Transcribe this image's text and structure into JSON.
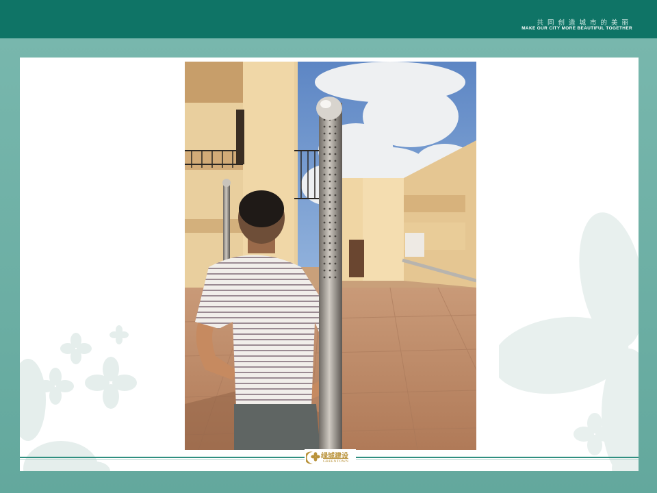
{
  "header": {
    "slogan_cn": "共同创造城市的美丽",
    "slogan_en": "MAKE OUR CITY MORE BEAUTIFUL TOGETHER"
  },
  "photo": {
    "subject": "man-standing-beside-perforated-stainless-pole-on-tiled-rooftop"
  },
  "footer": {
    "logo_cn": "绿城建设",
    "logo_en": "GREENTOWN"
  },
  "colors": {
    "header_bar": "#0f7466",
    "background": "#6fb0a6",
    "panel": "#ffffff",
    "logo_gold": "#b9923a"
  }
}
